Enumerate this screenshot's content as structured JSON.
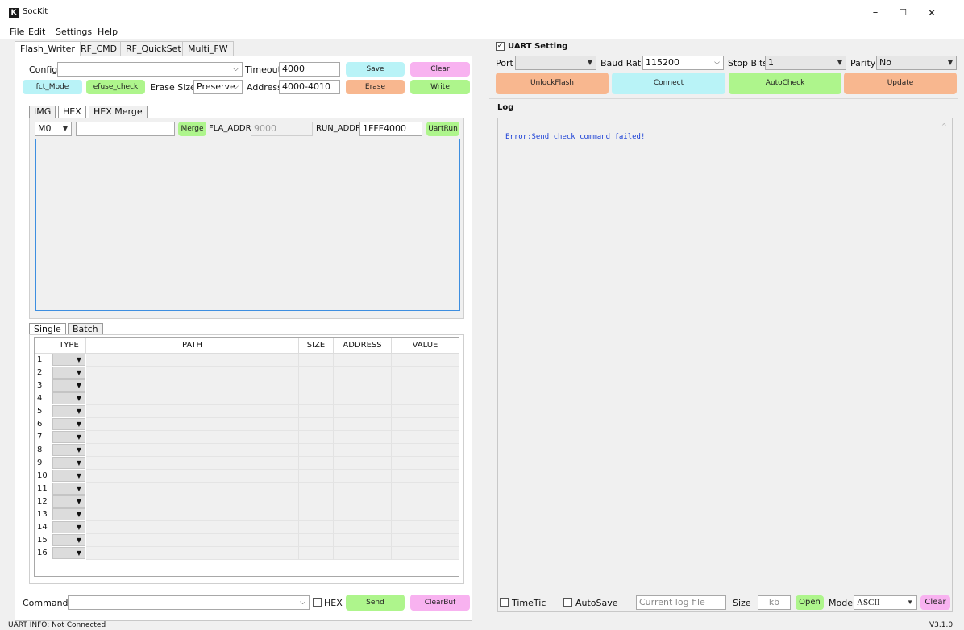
{
  "app": {
    "title": "SocKit",
    "logo_letter": "K",
    "version": "V3.1.0",
    "status": "UART INFO:  Not Connected"
  },
  "window_controls": {
    "minimize": "–",
    "maximize": "☐",
    "close": "✕"
  },
  "menu": [
    "File",
    "Edit",
    "Settings",
    "Help"
  ],
  "main_tabs": [
    "Flash_Writer",
    "RF_CMD",
    "RF_QuickSet",
    "Multi_FW"
  ],
  "flash_writer": {
    "config_label": "Config",
    "config_value": "",
    "timeout_label": "Timeout",
    "timeout_value": "4000",
    "save_label": "Save",
    "clear_label": "Clear",
    "fct_mode_label": "fct_Mode",
    "efuse_check_label": "efuse_check",
    "erase_size_label": "Erase Size",
    "erase_size_value": "Preserve",
    "address_label": "Address",
    "address_value": "4000-4010",
    "erase_label": "Erase",
    "write_label": "Write"
  },
  "sub_tabs": [
    "IMG",
    "HEX",
    "HEX Merge"
  ],
  "hex": {
    "core_value": "M0",
    "file_value": "",
    "merge_label": "Merge",
    "fla_addr_label": "FLA_ADDR",
    "fla_addr_value": "9000",
    "run_addr_label": "RUN_ADDR",
    "run_addr_value": "1FFF4000",
    "uartrun_label": "UartRun"
  },
  "table_tabs": [
    "Single",
    "Batch"
  ],
  "table": {
    "columns": [
      "TYPE",
      "PATH",
      "SIZE",
      "ADDRESS",
      "VALUE"
    ],
    "rows": [
      "1",
      "2",
      "3",
      "4",
      "5",
      "6",
      "7",
      "8",
      "9",
      "10",
      "11",
      "12",
      "13",
      "14",
      "15",
      "16"
    ]
  },
  "command": {
    "label": "Command:",
    "value": "",
    "hex_label": "HEX",
    "send_label": "Send",
    "clearbuf_label": "ClearBuf"
  },
  "uart": {
    "section_label": "UART Setting",
    "port_label": "Port",
    "port_value": "",
    "baud_label": "Baud Rate",
    "baud_value": "115200",
    "stop_label": "Stop Bits",
    "stop_value": "1",
    "parity_label": "Parity",
    "parity_value": "No",
    "unlock_label": "UnlockFlash",
    "connect_label": "Connect",
    "autocheck_label": "AutoCheck",
    "update_label": "Update"
  },
  "log": {
    "section_label": "Log",
    "line": "Error:Send check command failed!",
    "timetic_label": "TimeTic",
    "autosave_label": "AutoSave",
    "file_placeholder": "Current log file",
    "size_label": "Size",
    "size_placeholder": "kb",
    "open_label": "Open",
    "mode_label": "Mode",
    "mode_value": "ASCII",
    "clear_label": "Clear"
  },
  "colors": {
    "cyan": "#b9f3f7",
    "pink": "#f8b2f0",
    "green": "#aef58c",
    "orange": "#f8b78f",
    "log_text": "#1a3fd6"
  }
}
